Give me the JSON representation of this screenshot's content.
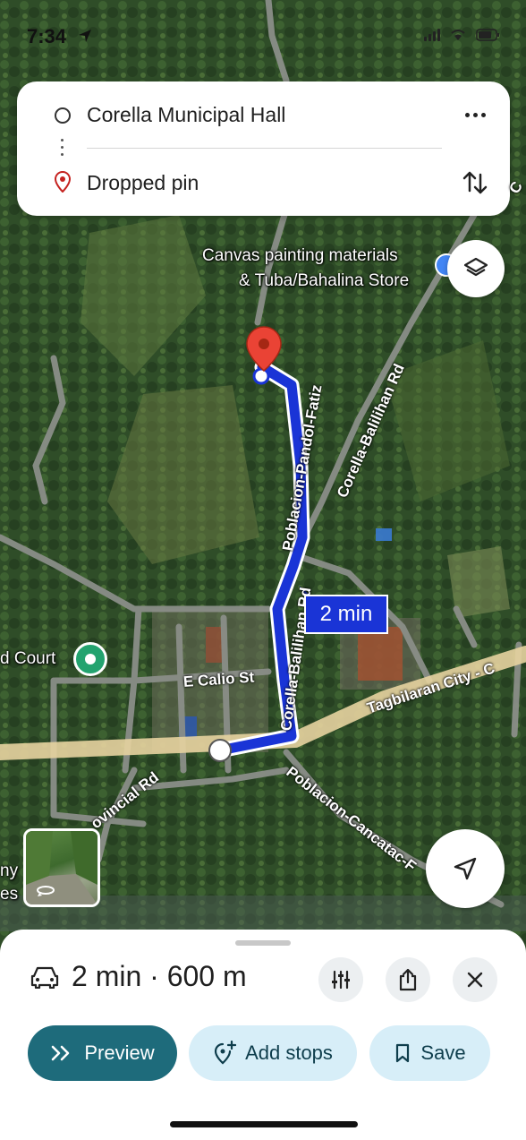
{
  "status_bar": {
    "time": "7:34"
  },
  "route": {
    "origin": "Corella Municipal Hall",
    "destination": "Dropped pin",
    "more_icon": "more-horizontal-icon",
    "swap_icon": "swap-vertical-icon"
  },
  "map": {
    "poi_canvas_line1": "Canvas painting materials",
    "poi_canvas_line2": "& Tuba/Bahalina Store",
    "poi_court": "d Court",
    "edge_left_line1": "ny",
    "edge_left_line2": "es",
    "edge_right_char": "C",
    "roads": {
      "poblacion_pandol": "Poblacion-Pandol-Fatiz",
      "corella_balilihan_upper": "Corella-Balilihan Rd",
      "corella_balilihan_lower": "Corella-Balilihan Rd",
      "e_calio": "E Calio St",
      "tagbilaran": "Tagbilaran City - C",
      "provincial": "ovincial Rd",
      "poblacion_cancatac": "Poblacion-Cancatac-F"
    },
    "route_time": "2 min",
    "route_color": "#1a34d6"
  },
  "sheet": {
    "summary": "2 min · 600 m",
    "mode_icon": "car-icon",
    "preview_label": "Preview",
    "add_stops_label": "Add stops",
    "save_label": "Save"
  }
}
